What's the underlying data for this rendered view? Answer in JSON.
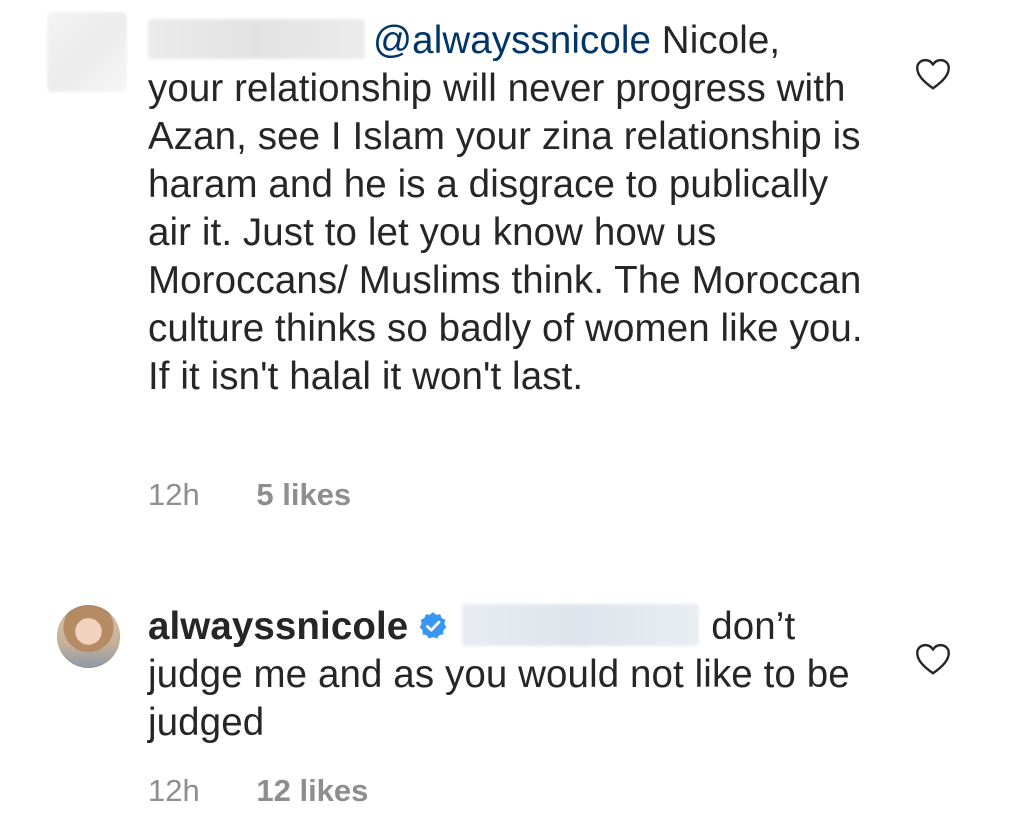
{
  "comments": [
    {
      "mention": "@alwayssnicole",
      "text_line1": " Nicole,",
      "text_rest": "your relationship will never progress with Azan, see I  Islam your zina relationship is haram and he is a disgrace to publically air it. Just to let you know how us Moroccans/ Muslims think. The Moroccan culture thinks so badly of women like you. If it isn't halal it won't last.",
      "time": "12h",
      "likes": "5 likes",
      "like_icon": "heart-outline-icon"
    },
    {
      "username": "alwayssnicole",
      "verified_icon": "verified-badge-icon",
      "text_tail": "don’t",
      "text_rest": "judge me and as you would not like to be judged",
      "time": "12h",
      "likes": "12 likes",
      "like_icon": "heart-outline-icon"
    }
  ],
  "colors": {
    "text": "#262626",
    "mention": "#003569",
    "meta": "#8e8e8e",
    "verified": "#3897f0"
  }
}
